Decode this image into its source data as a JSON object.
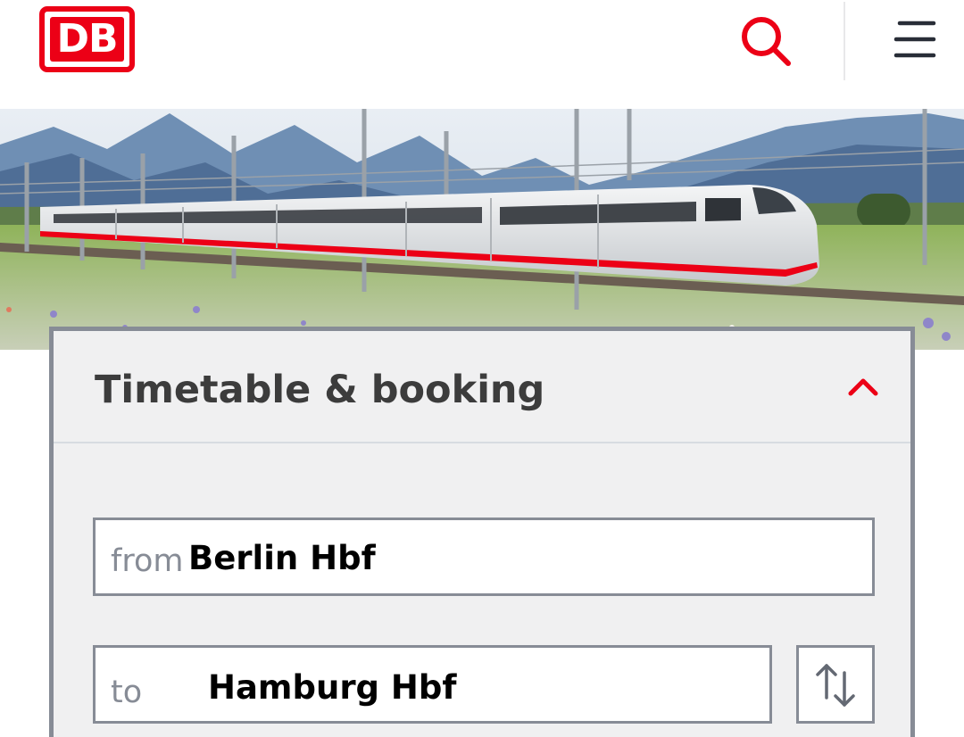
{
  "header": {
    "logo_text": "DB",
    "search_icon": "search-icon",
    "menu_icon": "hamburger-menu-icon"
  },
  "colors": {
    "brand_red": "#ec0016",
    "text_dark": "#3c3c3c",
    "border_gray": "#878c96",
    "panel_bg": "#f0f0f1"
  },
  "hero": {
    "image": "ICE train on a meadow in front of mountains"
  },
  "booking": {
    "title": "Timetable & booking",
    "collapse_icon": "chevron-up-icon",
    "from": {
      "label": "from",
      "value": "Berlin Hbf"
    },
    "to": {
      "label": "to",
      "value": "Hamburg Hbf"
    },
    "swap_icon": "swap-arrows-icon"
  }
}
